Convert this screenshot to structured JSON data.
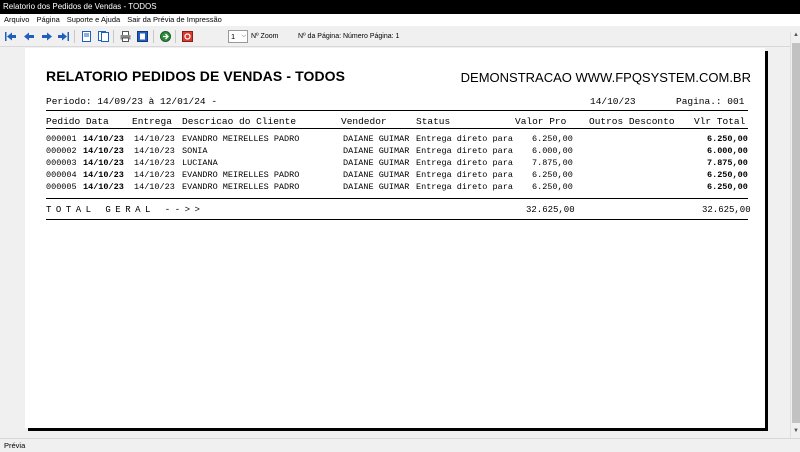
{
  "window": {
    "title": "Relatorio dos Pedidos de Vendas  - TODOS"
  },
  "menu": {
    "items": [
      "Arquivo",
      "Página",
      "Suporte e Ajuda",
      "Sair da Prévia de Impressão"
    ]
  },
  "toolbar": {
    "zoom_value": "1",
    "zoom_label": "Nº Zoom",
    "page_label": "Nº da Página: Número Página: 1"
  },
  "report": {
    "title": "RELATORIO PEDIDOS DE VENDAS  - TODOS",
    "company": "DEMONSTRACAO WWW.FPQSYSTEM.COM.BR",
    "periodo": "Periodo: 14/09/23 à 12/01/24 -",
    "date": "14/10/23",
    "page": "Pagina.: 001",
    "columns": {
      "pedido_data": "Pedido Data",
      "entrega": "Entrega",
      "cliente": "Descricao do Cliente",
      "vendedor": "Vendedor",
      "status": "Status",
      "valor": "Valor Pro",
      "outros": "Outros Desconto",
      "total": "Vlr Total"
    },
    "rows": [
      {
        "pedido": "000001",
        "data": "14/10/23",
        "entrega": "14/10/23",
        "cliente": "EVANDRO MEIRELLES PADRO",
        "vendedor": "DAIANE GUIMAR",
        "status": "Entrega direto para",
        "valor": "6.250,00",
        "total": "6.250,00"
      },
      {
        "pedido": "000002",
        "data": "14/10/23",
        "entrega": "14/10/23",
        "cliente": "SONIA",
        "vendedor": "DAIANE GUIMAR",
        "status": "Entrega direto para",
        "valor": "6.000,00",
        "total": "6.000,00"
      },
      {
        "pedido": "000003",
        "data": "14/10/23",
        "entrega": "14/10/23",
        "cliente": "LUCIANA",
        "vendedor": "DAIANE GUIMAR",
        "status": "Entrega direto para",
        "valor": "7.875,00",
        "total": "7.875,00"
      },
      {
        "pedido": "000004",
        "data": "14/10/23",
        "entrega": "14/10/23",
        "cliente": "EVANDRO MEIRELLES PADRO",
        "vendedor": "DAIANE GUIMAR",
        "status": "Entrega direto para",
        "valor": "6.250,00",
        "total": "6.250,00"
      },
      {
        "pedido": "000005",
        "data": "14/10/23",
        "entrega": "14/10/23",
        "cliente": "EVANDRO MEIRELLES PADRO",
        "vendedor": "DAIANE GUIMAR",
        "status": "Entrega direto para",
        "valor": "6.250,00",
        "total": "6.250,00"
      }
    ],
    "total_label": "TOTAL GERAL -->>",
    "total_valor": "32.625,00",
    "total_total": "32.625,00"
  },
  "statusbar": {
    "text": "Prévia"
  },
  "colors": {
    "nav_icon": "#1f5fbf",
    "titlebar": "#000000",
    "stop_icon": "#d93a2f"
  }
}
